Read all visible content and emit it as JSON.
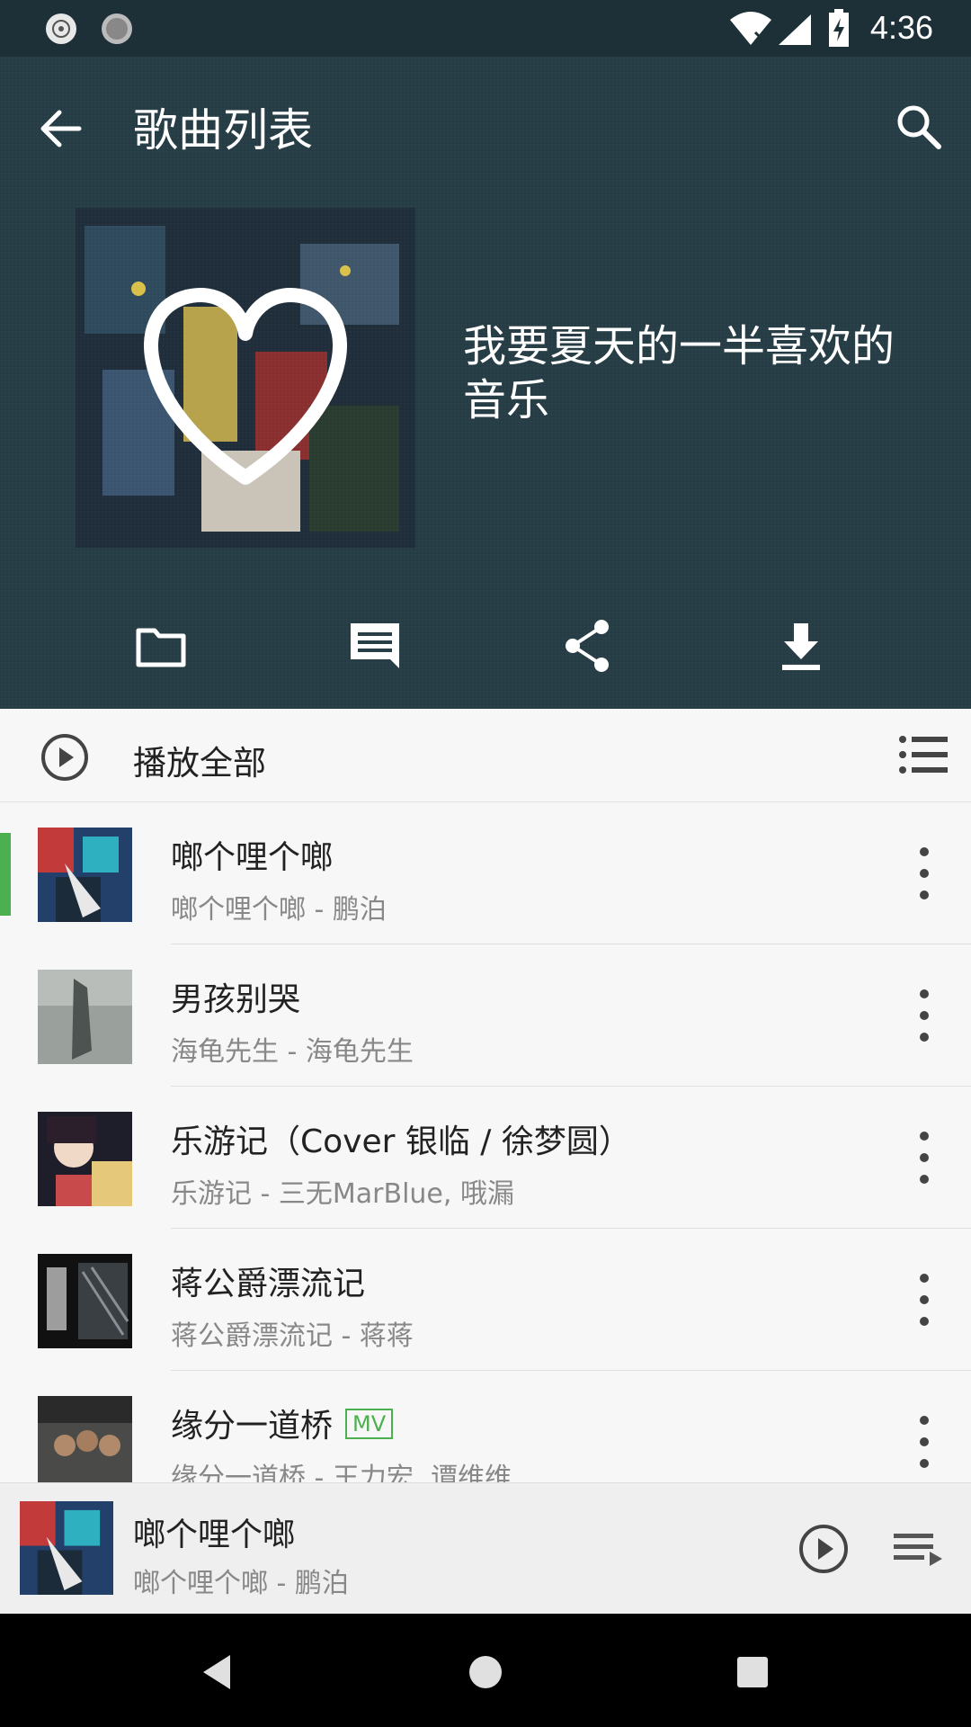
{
  "status_bar": {
    "time": "4:36",
    "icons": [
      "music-disc-icon",
      "loading-icon",
      "wifi-icon",
      "signal-icon",
      "battery-charging-icon"
    ]
  },
  "header": {
    "title": "歌曲列表",
    "playlist_name": "我要夏天的一半喜欢的音乐",
    "actions": [
      "folder-icon",
      "comment-icon",
      "share-icon",
      "download-icon"
    ]
  },
  "play_all": {
    "label": "播放全部"
  },
  "songs": [
    {
      "title": "啷个哩个啷",
      "subtitle": "啷个哩个啷 - 鹏泊",
      "playing": true,
      "mv": ""
    },
    {
      "title": "男孩别哭",
      "subtitle": "海龟先生 - 海龟先生",
      "playing": false,
      "mv": ""
    },
    {
      "title": "乐游记（Cover 银临 / 徐梦圆）",
      "subtitle": "乐游记 - 三无MarBlue, 哦漏",
      "playing": false,
      "mv": ""
    },
    {
      "title": "蒋公爵漂流记",
      "subtitle": "蒋公爵漂流记 - 蒋蒋",
      "playing": false,
      "mv": ""
    },
    {
      "title": "缘分一道桥",
      "subtitle": "缘分一道桥 - 王力宏, 谭维维",
      "playing": false,
      "mv": "MV"
    }
  ],
  "mini_player": {
    "title": "啷个哩个啷",
    "subtitle": "啷个哩个啷 - 鹏泊"
  },
  "colors": {
    "header_bg": "#263d46",
    "status_bg": "#1d2f37",
    "accent_green": "#4caf50"
  }
}
